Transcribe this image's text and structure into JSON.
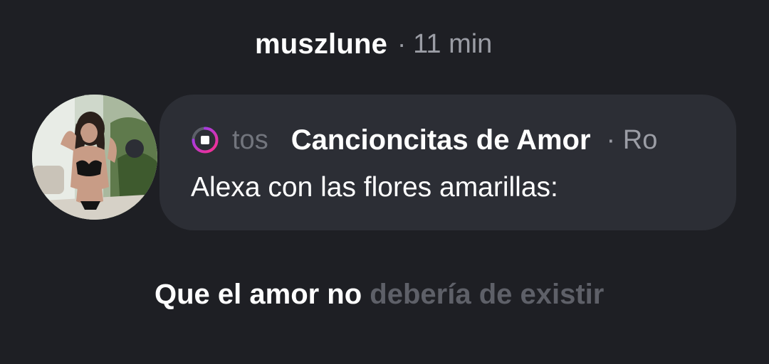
{
  "header": {
    "username": "muszlune",
    "separator": "·",
    "time": "11 min"
  },
  "note": {
    "icon": "music-progress-ring-icon",
    "scroll_prev": "tos",
    "song_title": "Cancioncitas de Amor",
    "scroll_next": "· Ro",
    "text": "Alexa con las flores amarillas:"
  },
  "lyrics": {
    "sung": "Que el amor no",
    "upcoming": "debería de existir"
  },
  "colors": {
    "background": "#1e1f24",
    "bubble": "#2c2e35",
    "ring_gradient_start": "#8a3ffc",
    "ring_gradient_end": "#ff2e8a"
  }
}
